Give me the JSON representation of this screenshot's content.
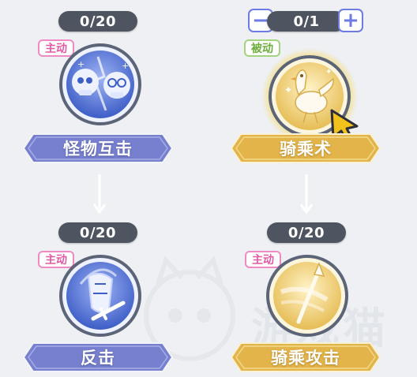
{
  "skills": [
    {
      "id": "monster-clash",
      "counter": "0/20",
      "type": "主动",
      "name": "怪物互击"
    },
    {
      "id": "riding",
      "counter": "0/1",
      "type": "被动",
      "name": "骑乘术"
    },
    {
      "id": "counterattack",
      "counter": "0/20",
      "type": "主动",
      "name": "反击"
    },
    {
      "id": "riding-attack",
      "counter": "0/20",
      "type": "主动",
      "name": "骑乘攻击"
    }
  ],
  "stepper": {
    "minus": "−",
    "plus": "+"
  },
  "watermark": {
    "text": "游戏猫"
  },
  "colors": {
    "background": "#eef0f3",
    "blue_banner": "#7680cf",
    "gold_banner": "#e2b44a",
    "active_badge": "#e25aa4",
    "passive_badge": "#6cae3c",
    "counter": "#4f5560",
    "selected_glow": "#f5d64a"
  },
  "icons": {
    "monster-clash": "colliding-monster-skulls-icon",
    "riding": "chocobo-bird-icon",
    "counterattack": "shield-and-sword-icon",
    "riding-attack": "lance-charge-icon",
    "cursor": "pointer-cursor-icon"
  }
}
